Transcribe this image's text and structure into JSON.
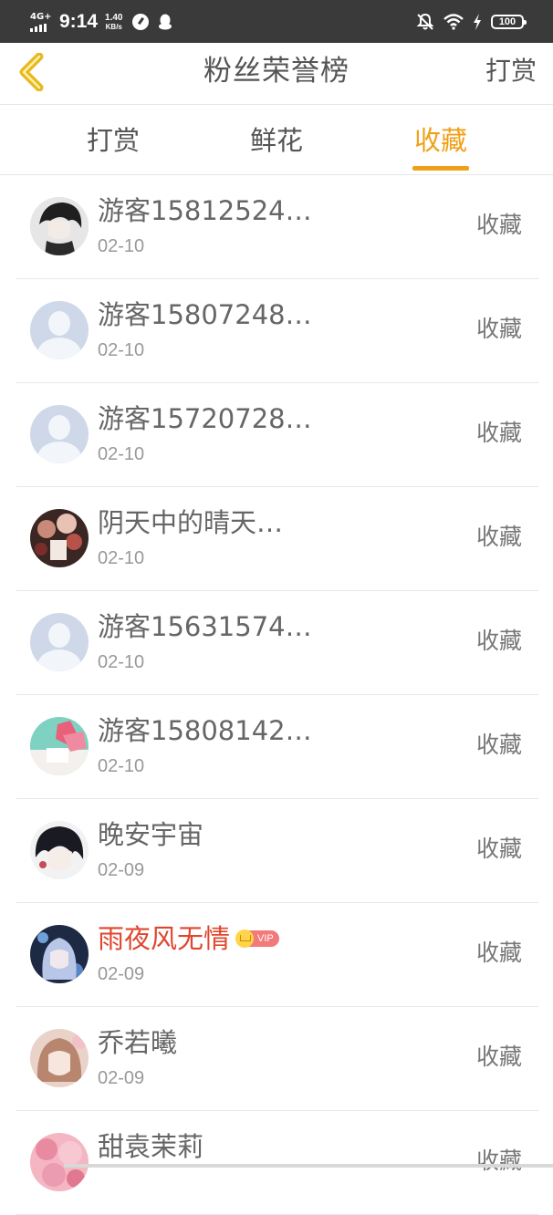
{
  "status_bar": {
    "network": "4G+",
    "time": "9:14",
    "speed_value": "1.40",
    "speed_unit": "KB/s",
    "battery": "100"
  },
  "header": {
    "title": "粉丝荣誉榜",
    "action_label": "打赏"
  },
  "tabs": [
    {
      "label": "打赏",
      "active": false
    },
    {
      "label": "鲜花",
      "active": false
    },
    {
      "label": "收藏",
      "active": true
    }
  ],
  "accent_color": "#f0a018",
  "vip_label": "VIP",
  "fans": [
    {
      "name": "游客15812524…",
      "date": "02-10",
      "action": "收藏",
      "avatar": "anime-boy-avatar"
    },
    {
      "name": "游客15807248…",
      "date": "02-10",
      "action": "收藏",
      "avatar": "default-avatar"
    },
    {
      "name": "游客15720728…",
      "date": "02-10",
      "action": "收藏",
      "avatar": "default-avatar"
    },
    {
      "name": "阴天中的晴天…",
      "date": "02-10",
      "action": "收藏",
      "avatar": "flowers-avatar"
    },
    {
      "name": "游客15631574…",
      "date": "02-10",
      "action": "收藏",
      "avatar": "default-avatar"
    },
    {
      "name": "游客15808142…",
      "date": "02-10",
      "action": "收藏",
      "avatar": "pink-flower-avatar"
    },
    {
      "name": "晚安宇宙",
      "date": "02-09",
      "action": "收藏",
      "avatar": "dark-hair-avatar"
    },
    {
      "name": "雨夜风无情",
      "date": "02-09",
      "action": "收藏",
      "avatar": "anime-girl-avatar",
      "vip": true
    },
    {
      "name": "乔若曦",
      "date": "02-09",
      "action": "收藏",
      "avatar": "girl-photo-avatar"
    },
    {
      "name": "甜袁茉莉",
      "date": "",
      "action": "收藏",
      "avatar": "pink-roses-avatar"
    }
  ]
}
